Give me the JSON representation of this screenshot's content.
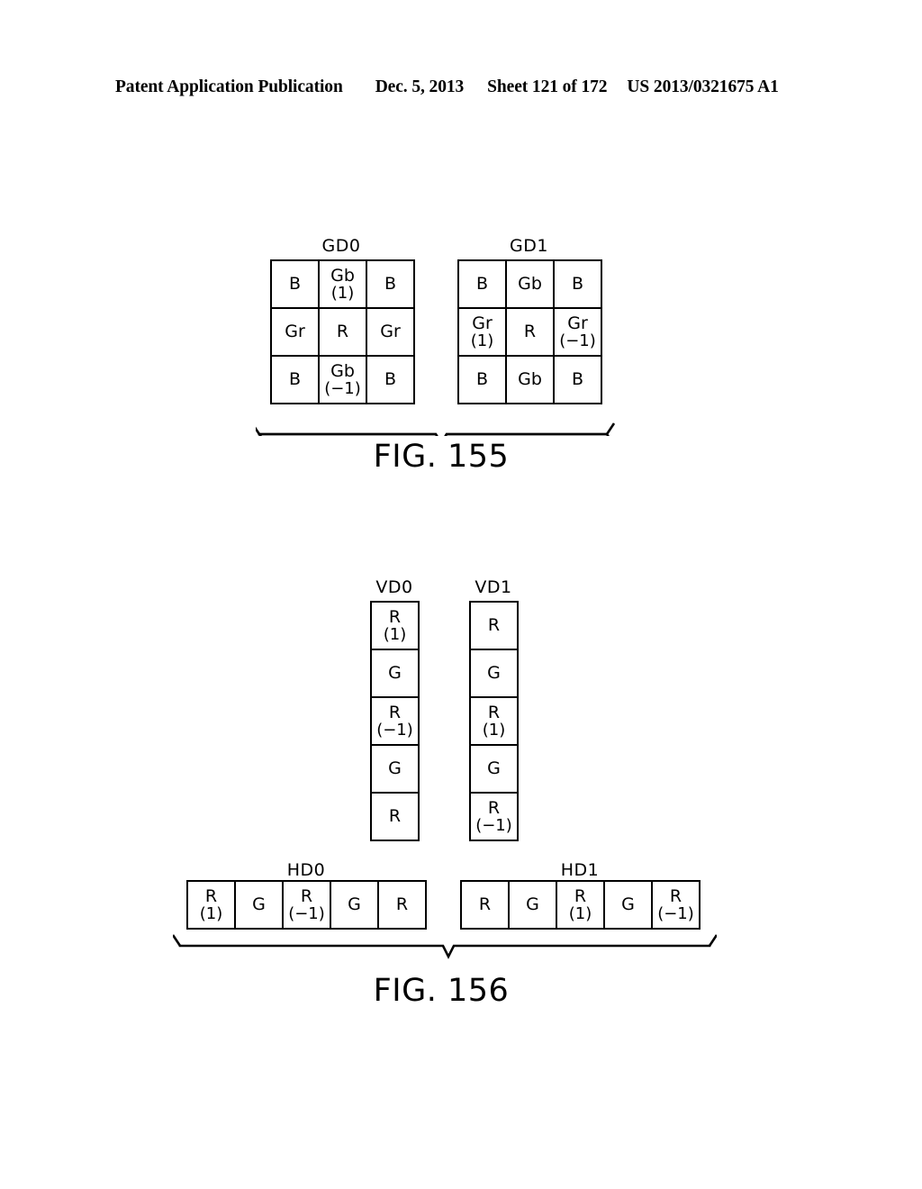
{
  "header": {
    "publication": "Patent Application Publication",
    "date": "Dec. 5, 2013",
    "sheet": "Sheet 121 of 172",
    "patent_number": "US 2013/0321675 A1"
  },
  "figures": [
    {
      "caption": "FIG. 155",
      "groups": [
        {
          "label": "GD0",
          "type": "grid3x3",
          "cells": [
            {
              "main": "B",
              "sub": ""
            },
            {
              "main": "Gb",
              "sub": "(1)"
            },
            {
              "main": "B",
              "sub": ""
            },
            {
              "main": "Gr",
              "sub": ""
            },
            {
              "main": "R",
              "sub": ""
            },
            {
              "main": "Gr",
              "sub": ""
            },
            {
              "main": "B",
              "sub": ""
            },
            {
              "main": "Gb",
              "sub": "(−1)"
            },
            {
              "main": "B",
              "sub": ""
            }
          ]
        },
        {
          "label": "GD1",
          "type": "grid3x3",
          "cells": [
            {
              "main": "B",
              "sub": ""
            },
            {
              "main": "Gb",
              "sub": ""
            },
            {
              "main": "B",
              "sub": ""
            },
            {
              "main": "Gr",
              "sub": "(1)"
            },
            {
              "main": "R",
              "sub": ""
            },
            {
              "main": "Gr",
              "sub": "(−1)"
            },
            {
              "main": "B",
              "sub": ""
            },
            {
              "main": "Gb",
              "sub": ""
            },
            {
              "main": "B",
              "sub": ""
            }
          ]
        }
      ]
    },
    {
      "caption": "FIG. 156",
      "groups": [
        {
          "label": "VD0",
          "type": "column5",
          "cells": [
            {
              "main": "R",
              "sub": "(1)"
            },
            {
              "main": "G",
              "sub": ""
            },
            {
              "main": "R",
              "sub": "(−1)"
            },
            {
              "main": "G",
              "sub": ""
            },
            {
              "main": "R",
              "sub": ""
            }
          ]
        },
        {
          "label": "VD1",
          "type": "column5",
          "cells": [
            {
              "main": "R",
              "sub": ""
            },
            {
              "main": "G",
              "sub": ""
            },
            {
              "main": "R",
              "sub": "(1)"
            },
            {
              "main": "G",
              "sub": ""
            },
            {
              "main": "R",
              "sub": "(−1)"
            }
          ]
        },
        {
          "label": "HD0",
          "type": "row5",
          "cells": [
            {
              "main": "R",
              "sub": "(1)"
            },
            {
              "main": "G",
              "sub": ""
            },
            {
              "main": "R",
              "sub": "(−1)"
            },
            {
              "main": "G",
              "sub": ""
            },
            {
              "main": "R",
              "sub": ""
            }
          ]
        },
        {
          "label": "HD1",
          "type": "row5",
          "cells": [
            {
              "main": "R",
              "sub": ""
            },
            {
              "main": "G",
              "sub": ""
            },
            {
              "main": "R",
              "sub": "(1)"
            },
            {
              "main": "G",
              "sub": ""
            },
            {
              "main": "R",
              "sub": "(−1)"
            }
          ]
        }
      ]
    }
  ]
}
